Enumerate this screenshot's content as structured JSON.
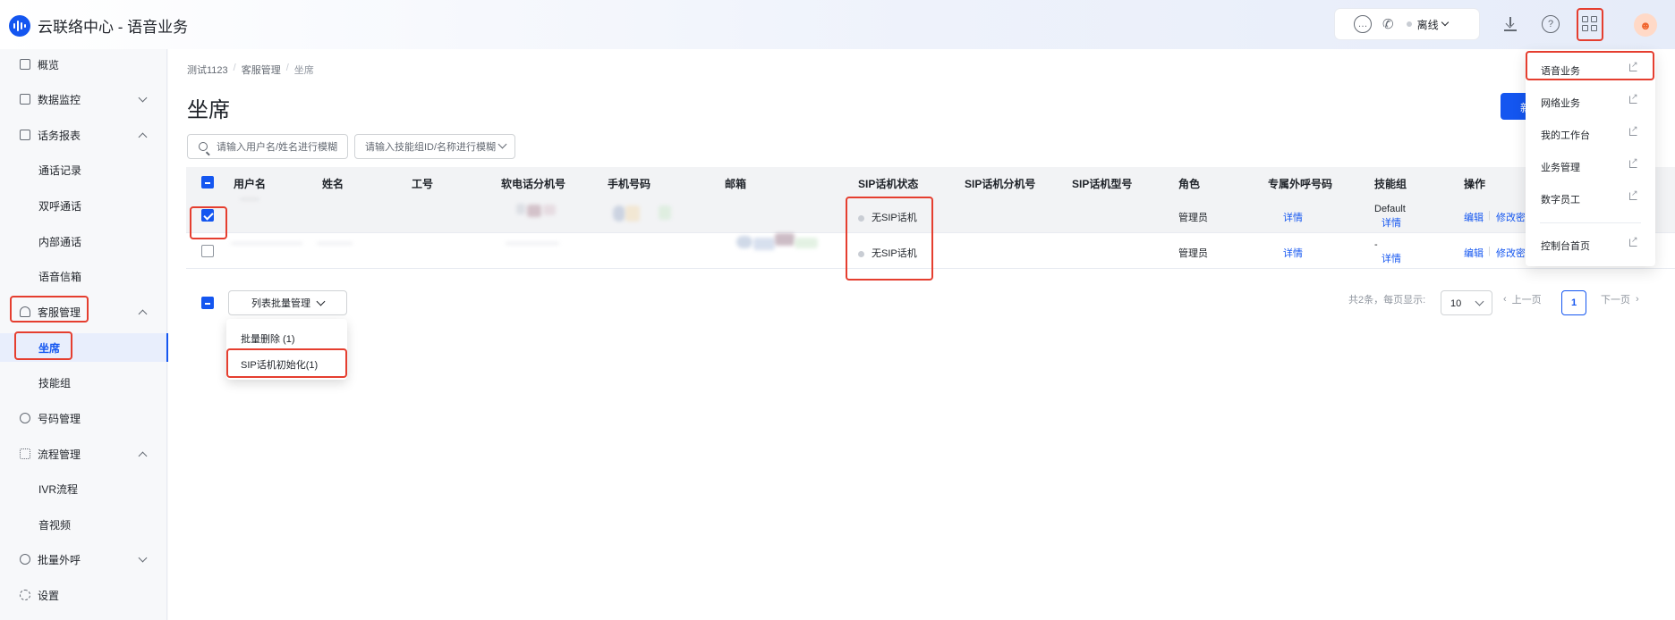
{
  "app": {
    "title": "云联络中心 - 语音业务",
    "accent": "#1456f0"
  },
  "header": {
    "status_label": "离线"
  },
  "sidebar": {
    "items": [
      {
        "label": "概览"
      },
      {
        "label": "数据监控"
      },
      {
        "label": "话务报表"
      },
      {
        "label": "通话记录"
      },
      {
        "label": "双呼通话"
      },
      {
        "label": "内部通话"
      },
      {
        "label": "语音信箱"
      },
      {
        "label": "客服管理"
      },
      {
        "label": "坐席"
      },
      {
        "label": "技能组"
      },
      {
        "label": "号码管理"
      },
      {
        "label": "流程管理"
      },
      {
        "label": "IVR流程"
      },
      {
        "label": "音视频"
      },
      {
        "label": "批量外呼"
      },
      {
        "label": "设置"
      }
    ]
  },
  "breadcrumb": {
    "items": [
      "测试1123",
      "客服管理",
      "坐席"
    ]
  },
  "page": {
    "title": "坐席",
    "primary_button_label": "新"
  },
  "filters": {
    "user_placeholder": "请输入用户名/姓名进行模糊",
    "skill_placeholder": "请输入技能组ID/名称进行模糊"
  },
  "table": {
    "columns": [
      "用户名",
      "姓名",
      "工号",
      "软电话分机号",
      "手机号码",
      "邮箱",
      "SIP话机状态",
      "SIP话机分机号",
      "SIP话机型号",
      "角色",
      "专属外呼号码",
      "技能组",
      "操作"
    ],
    "rows": [
      {
        "sip_status": "无SIP话机",
        "role": "管理员",
        "exclusive_number": "详情",
        "skill_group": "Default",
        "skill_link": "详情",
        "op_edit": "编辑",
        "op_more": "修改密"
      },
      {
        "sip_status": "无SIP话机",
        "role": "管理员",
        "exclusive_number": "详情",
        "skill_group": "-",
        "skill_link": "详情",
        "op_edit": "编辑",
        "op_more": "修改密"
      }
    ]
  },
  "bulk": {
    "button_label": "列表批量管理",
    "menu": [
      "批量删除 (1)",
      "SIP话机初始化(1)"
    ]
  },
  "pagination": {
    "total_label": "共2条，每页显示:",
    "page_size": "10",
    "prev": "上一页",
    "current": "1",
    "next": "下一页"
  },
  "app_menu": {
    "items": [
      "语音业务",
      "网络业务",
      "我的工作台",
      "业务管理",
      "数字员工",
      "控制台首页"
    ]
  }
}
